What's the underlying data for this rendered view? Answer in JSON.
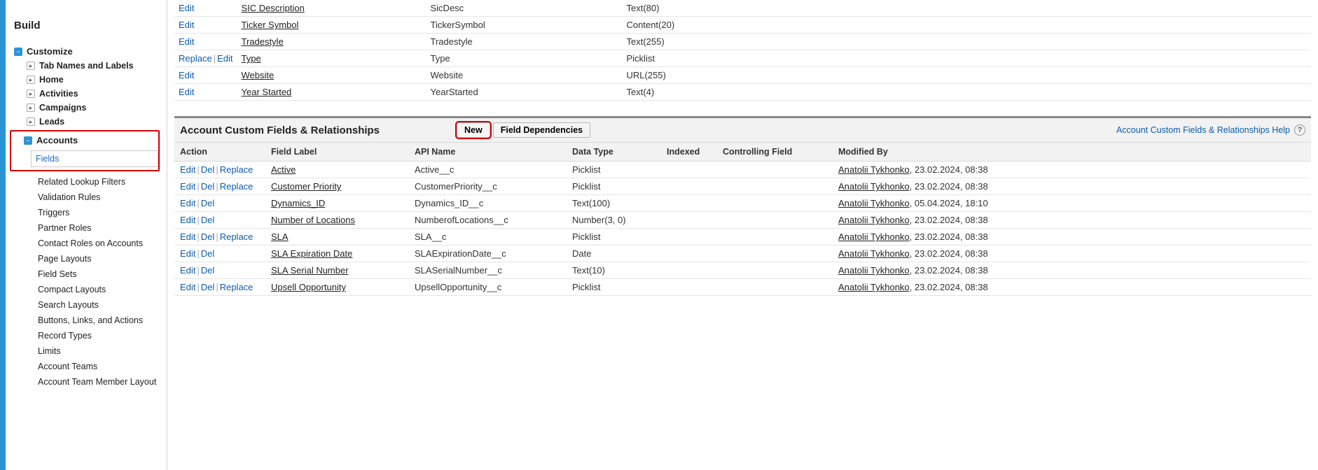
{
  "sidebar": {
    "heading": "Build",
    "root": {
      "label": "Customize"
    },
    "items": [
      {
        "label": "Tab Names and Labels"
      },
      {
        "label": "Home"
      },
      {
        "label": "Activities"
      },
      {
        "label": "Campaigns"
      },
      {
        "label": "Leads"
      }
    ],
    "accounts": {
      "label": "Accounts",
      "selected": "Fields",
      "children": [
        "Related Lookup Filters",
        "Validation Rules",
        "Triggers",
        "Partner Roles",
        "Contact Roles on Accounts",
        "Page Layouts",
        "Field Sets",
        "Compact Layouts",
        "Search Layouts",
        "Buttons, Links, and Actions",
        "Record Types",
        "Limits",
        "Account Teams",
        "Account Team Member Layout"
      ]
    }
  },
  "actions": {
    "edit": "Edit",
    "del": "Del",
    "replace": "Replace"
  },
  "standardFields": [
    {
      "action_mode": "edit",
      "label": "SIC Description",
      "api": "SicDesc",
      "type": "Text(80)"
    },
    {
      "action_mode": "edit",
      "label": "Ticker Symbol",
      "api": "TickerSymbol",
      "type": "Content(20)"
    },
    {
      "action_mode": "edit",
      "label": "Tradestyle",
      "api": "Tradestyle",
      "type": "Text(255)"
    },
    {
      "action_mode": "replace_edit",
      "label": "Type",
      "api": "Type",
      "type": "Picklist"
    },
    {
      "action_mode": "edit",
      "label": "Website",
      "api": "Website",
      "type": "URL(255)"
    },
    {
      "action_mode": "edit",
      "label": "Year Started",
      "api": "YearStarted",
      "type": "Text(4)"
    }
  ],
  "section2": {
    "title": "Account Custom Fields & Relationships",
    "btn_new": "New",
    "btn_deps": "Field Dependencies",
    "help": "Account Custom Fields & Relationships Help",
    "columns": {
      "action": "Action",
      "label": "Field Label",
      "api": "API Name",
      "type": "Data Type",
      "indexed": "Indexed",
      "ctrl": "Controlling Field",
      "mod": "Modified By"
    }
  },
  "customFields": [
    {
      "actions": "edr",
      "label": "Active",
      "api": "Active__c",
      "type": "Picklist",
      "user": "Anatolii Tykhonko",
      "ts": "23.02.2024, 08:38"
    },
    {
      "actions": "edr",
      "label": "Customer Priority",
      "api": "CustomerPriority__c",
      "type": "Picklist",
      "user": "Anatolii Tykhonko",
      "ts": "23.02.2024, 08:38"
    },
    {
      "actions": "ed",
      "label": "Dynamics_ID",
      "api": "Dynamics_ID__c",
      "type": "Text(100)",
      "user": "Anatolii Tykhonko",
      "ts": "05.04.2024, 18:10"
    },
    {
      "actions": "ed",
      "label": "Number of Locations",
      "api": "NumberofLocations__c",
      "type": "Number(3, 0)",
      "user": "Anatolii Tykhonko",
      "ts": "23.02.2024, 08:38"
    },
    {
      "actions": "edr",
      "label": "SLA",
      "api": "SLA__c",
      "type": "Picklist",
      "user": "Anatolii Tykhonko",
      "ts": "23.02.2024, 08:38"
    },
    {
      "actions": "ed",
      "label": "SLA Expiration Date",
      "api": "SLAExpirationDate__c",
      "type": "Date",
      "user": "Anatolii Tykhonko",
      "ts": "23.02.2024, 08:38"
    },
    {
      "actions": "ed",
      "label": "SLA Serial Number",
      "api": "SLASerialNumber__c",
      "type": "Text(10)",
      "user": "Anatolii Tykhonko",
      "ts": "23.02.2024, 08:38"
    },
    {
      "actions": "edr",
      "label": "Upsell Opportunity",
      "api": "UpsellOpportunity__c",
      "type": "Picklist",
      "user": "Anatolii Tykhonko",
      "ts": "23.02.2024, 08:38"
    }
  ]
}
